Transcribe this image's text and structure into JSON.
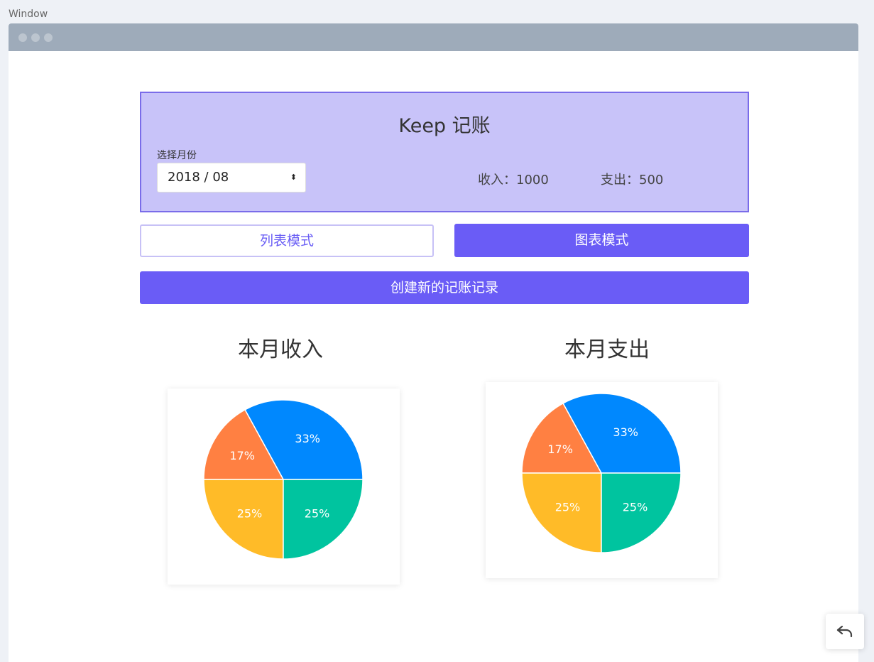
{
  "outer": {
    "label": "Window"
  },
  "header": {
    "title": "Keep 记账",
    "month_label": "选择月份",
    "month_value": "2018 / 08",
    "income_text": "收入：1000",
    "expense_text": "支出：500"
  },
  "tabs": {
    "list_mode": "列表模式",
    "chart_mode": "图表模式"
  },
  "create_button": "创建新的记账记录",
  "charts": {
    "income_title": "本月收入",
    "expense_title": "本月支出"
  },
  "colors": {
    "accent": "#6a5cf6",
    "header_bg": "#c8c3f9",
    "slice_blue": "#0088fe",
    "slice_orange": "#ff8042",
    "slice_yellow": "#ffbb28",
    "slice_green": "#00c49f"
  },
  "chart_data": [
    {
      "type": "pie",
      "title": "本月收入",
      "slices": [
        {
          "label": "33%",
          "value": 33,
          "color": "#0088fe"
        },
        {
          "label": "17%",
          "value": 17,
          "color": "#ff8042"
        },
        {
          "label": "25%",
          "value": 25,
          "color": "#ffbb28"
        },
        {
          "label": "25%",
          "value": 25,
          "color": "#00c49f"
        }
      ]
    },
    {
      "type": "pie",
      "title": "本月支出",
      "slices": [
        {
          "label": "33%",
          "value": 33,
          "color": "#0088fe"
        },
        {
          "label": "17%",
          "value": 17,
          "color": "#ff8042"
        },
        {
          "label": "25%",
          "value": 25,
          "color": "#ffbb28"
        },
        {
          "label": "25%",
          "value": 25,
          "color": "#00c49f"
        }
      ]
    }
  ],
  "icons": {
    "undo": "undo-icon",
    "select_arrow": "updown-arrow-icon"
  }
}
